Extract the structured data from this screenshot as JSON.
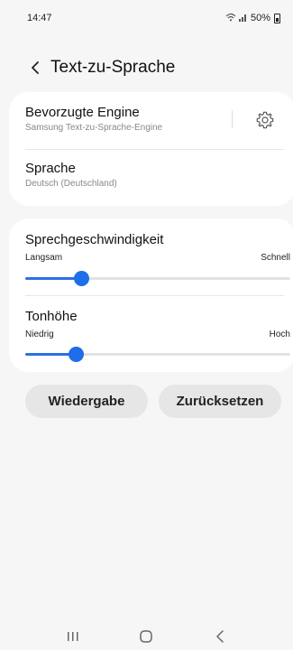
{
  "status_bar": {
    "time": "14:47",
    "battery": "50%"
  },
  "header": {
    "title": "Text-zu-Sprache"
  },
  "engine": {
    "label": "Bevorzugte Engine",
    "value": "Samsung Text-zu-Sprache-Engine"
  },
  "language": {
    "label": "Sprache",
    "value": "Deutsch (Deutschland)"
  },
  "speech_rate": {
    "label": "Sprechgeschwindigkeit",
    "min_label": "Langsam",
    "max_label": "Schnell",
    "level": 0.21
  },
  "pitch": {
    "label": "Tonhöhe",
    "min_label": "Niedrig",
    "max_label": "Hoch",
    "level": 0.19
  },
  "buttons": {
    "play": "Wiedergabe",
    "reset": "Zurücksetzen"
  },
  "colors": {
    "accent": "#1d6ee8",
    "background": "#f6f6f6",
    "card": "#ffffff"
  },
  "icons": {
    "back": "chevron-left-icon",
    "settings": "gear-icon",
    "recents": "recents-icon",
    "home": "home-icon",
    "nav_back": "back-icon"
  }
}
